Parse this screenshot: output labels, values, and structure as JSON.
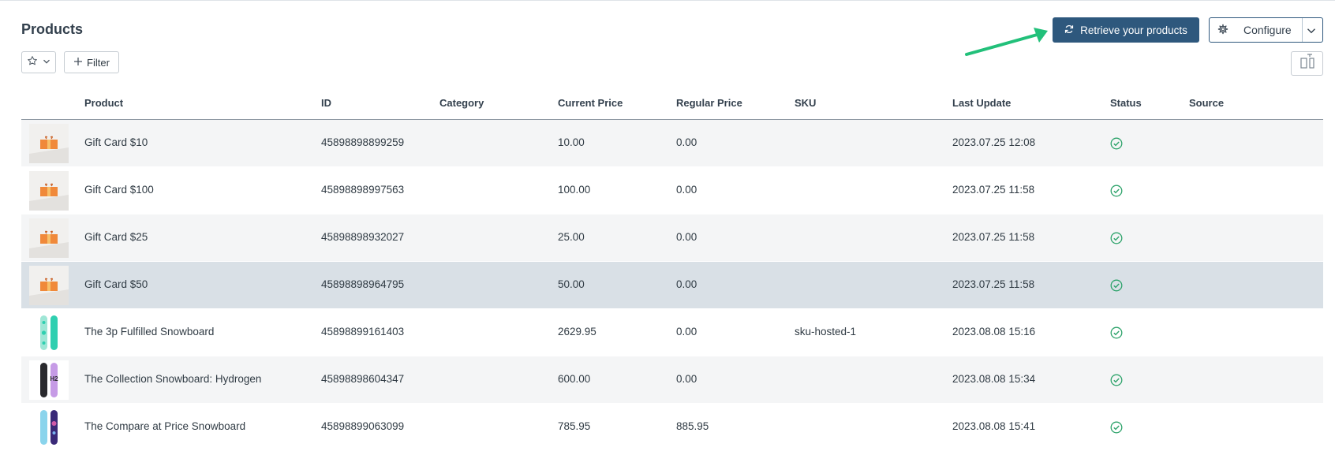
{
  "header": {
    "title": "Products",
    "filter_label": "Filter",
    "retrieve_label": "Retrieve your products",
    "configure_label": "Configure"
  },
  "table": {
    "columns": [
      "Product",
      "ID",
      "Category",
      "Current Price",
      "Regular Price",
      "SKU",
      "Last Update",
      "Status",
      "Source"
    ],
    "rows": [
      {
        "product": "Gift Card $10",
        "id": "45898898899259",
        "category": "",
        "current_price": "10.00",
        "regular_price": "0.00",
        "sku": "",
        "last_update": "2023.07.25 12:08",
        "status": "check-icon",
        "source": "",
        "thumb": "gift-card"
      },
      {
        "product": "Gift Card $100",
        "id": "45898898997563",
        "category": "",
        "current_price": "100.00",
        "regular_price": "0.00",
        "sku": "",
        "last_update": "2023.07.25 11:58",
        "status": "check-icon",
        "source": "",
        "thumb": "gift-card"
      },
      {
        "product": "Gift Card $25",
        "id": "45898898932027",
        "category": "",
        "current_price": "25.00",
        "regular_price": "0.00",
        "sku": "",
        "last_update": "2023.07.25 11:58",
        "status": "check-icon",
        "source": "",
        "thumb": "gift-card"
      },
      {
        "product": "Gift Card $50",
        "id": "45898898964795",
        "category": "",
        "current_price": "50.00",
        "regular_price": "0.00",
        "sku": "",
        "last_update": "2023.07.25 11:58",
        "status": "check-icon",
        "source": "",
        "thumb": "gift-card"
      },
      {
        "product": "The 3p Fulfilled Snowboard",
        "id": "45898899161403",
        "category": "",
        "current_price": "2629.95",
        "regular_price": "0.00",
        "sku": "sku-hosted-1",
        "last_update": "2023.08.08 15:16",
        "status": "check-icon",
        "source": "",
        "thumb": "snowboard-teal"
      },
      {
        "product": "The Collection Snowboard: Hydrogen",
        "id": "45898898604347",
        "category": "",
        "current_price": "600.00",
        "regular_price": "0.00",
        "sku": "",
        "last_update": "2023.08.08 15:34",
        "status": "check-icon",
        "source": "",
        "thumb": "snowboard-black-purple"
      },
      {
        "product": "The Compare at Price Snowboard",
        "id": "45898899063099",
        "category": "",
        "current_price": "785.95",
        "regular_price": "885.95",
        "sku": "",
        "last_update": "2023.08.08 15:41",
        "status": "check-icon",
        "source": "",
        "thumb": "snowboard-blue-galaxy"
      }
    ]
  },
  "colors": {
    "primary": "#2e587d",
    "status_ok": "#2ea36b",
    "arrow": "#22c07a",
    "row_stripe": "#f4f5f6",
    "row_selected": "#d9e0e6"
  }
}
